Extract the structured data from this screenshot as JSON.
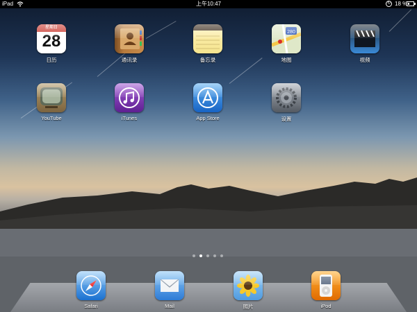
{
  "status_bar": {
    "carrier": "iPad",
    "time": "上午10:47",
    "battery_percent": "18 %",
    "battery_level": 0.18
  },
  "home_apps": [
    {
      "label": "日历",
      "icon": "calendar-icon",
      "calendar_weekday": "星期日",
      "calendar_day": "28"
    },
    {
      "label": "通讯录",
      "icon": "contacts-icon"
    },
    {
      "label": "备忘录",
      "icon": "notes-icon"
    },
    {
      "label": "地图",
      "icon": "maps-icon",
      "map_route_number": "280"
    },
    {
      "label": "视频",
      "icon": "videos-icon"
    },
    {
      "label": "YouTube",
      "icon": "youtube-icon"
    },
    {
      "label": "iTunes",
      "icon": "itunes-icon"
    },
    {
      "label": "App Store",
      "icon": "app-store-icon"
    },
    {
      "label": "设置",
      "icon": "settings-icon"
    }
  ],
  "page_indicator": {
    "pages": 5,
    "current": 2
  },
  "dock_apps": [
    {
      "label": "Safari",
      "icon": "safari-icon"
    },
    {
      "label": "Mail",
      "icon": "mail-icon"
    },
    {
      "label": "照片",
      "icon": "photos-icon"
    },
    {
      "label": "iPod",
      "icon": "ipod-icon"
    }
  ]
}
